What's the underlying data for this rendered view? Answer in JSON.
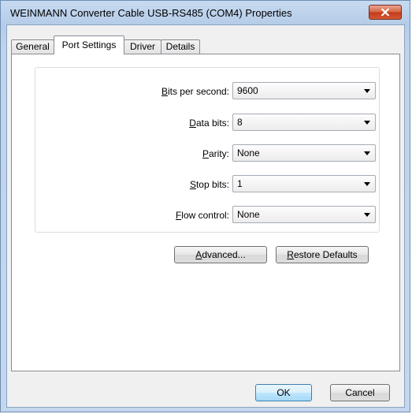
{
  "window": {
    "title": "WEINMANN Converter Cable USB-RS485 (COM4) Properties"
  },
  "tabs": [
    {
      "label": "General",
      "active": false
    },
    {
      "label": "Port Settings",
      "active": true
    },
    {
      "label": "Driver",
      "active": false
    },
    {
      "label": "Details",
      "active": false
    }
  ],
  "settings": {
    "bits_per_second": {
      "mnemonic": "B",
      "label_rest": "its per second:",
      "value": "9600"
    },
    "data_bits": {
      "mnemonic": "D",
      "label_rest": "ata bits:",
      "value": "8"
    },
    "parity": {
      "mnemonic": "P",
      "label_rest": "arity:",
      "value": "None"
    },
    "stop_bits": {
      "mnemonic": "S",
      "label_rest": "top bits:",
      "value": "1"
    },
    "flow_control": {
      "mnemonic": "F",
      "label_rest": "low control:",
      "value": "None"
    }
  },
  "buttons": {
    "advanced": {
      "mnemonic": "A",
      "rest": "dvanced..."
    },
    "restore": {
      "mnemonic": "R",
      "rest": "estore Defaults"
    },
    "ok": "OK",
    "cancel": "Cancel"
  },
  "colors": {
    "close_button": "#c4391a",
    "default_button_border": "#3c7fb1"
  },
  "icons": {
    "close": "close-icon",
    "dropdown": "chevron-down-icon"
  }
}
